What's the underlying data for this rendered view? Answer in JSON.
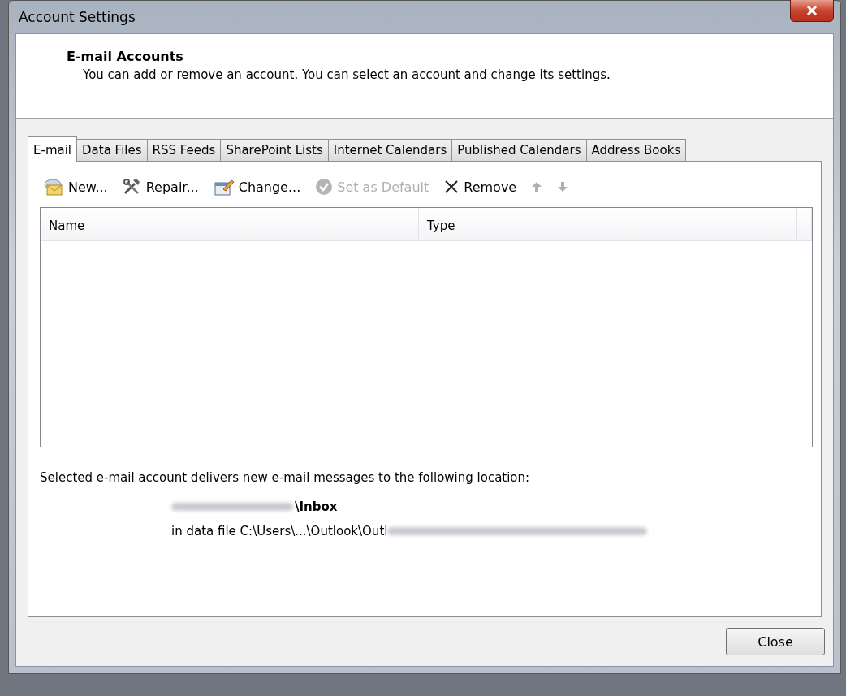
{
  "window": {
    "title": "Account Settings"
  },
  "header": {
    "title": "E-mail Accounts",
    "description": "You can add or remove an account. You can select an account and change its settings."
  },
  "tabs": [
    {
      "label": "E-mail",
      "selected": true
    },
    {
      "label": "Data Files",
      "selected": false
    },
    {
      "label": "RSS Feeds",
      "selected": false
    },
    {
      "label": "SharePoint Lists",
      "selected": false
    },
    {
      "label": "Internet Calendars",
      "selected": false
    },
    {
      "label": "Published Calendars",
      "selected": false
    },
    {
      "label": "Address Books",
      "selected": false
    }
  ],
  "toolbar": [
    {
      "label": "New...",
      "disabled": false
    },
    {
      "label": "Repair...",
      "disabled": false
    },
    {
      "label": "Change...",
      "disabled": false
    },
    {
      "label": "Set as Default",
      "disabled": true
    },
    {
      "label": "Remove",
      "disabled": false
    },
    {
      "disabled": true
    },
    {
      "disabled": true
    }
  ],
  "table": {
    "columns": [
      "Name",
      "Type"
    ]
  },
  "delivery": {
    "text": "Selected e-mail account delivers new e-mail messages to the following location:",
    "folder": "\\Inbox",
    "data_file": "in data file C:\\Users\\...\\Outlook\\Outl"
  },
  "buttons": [
    "Close"
  ]
}
